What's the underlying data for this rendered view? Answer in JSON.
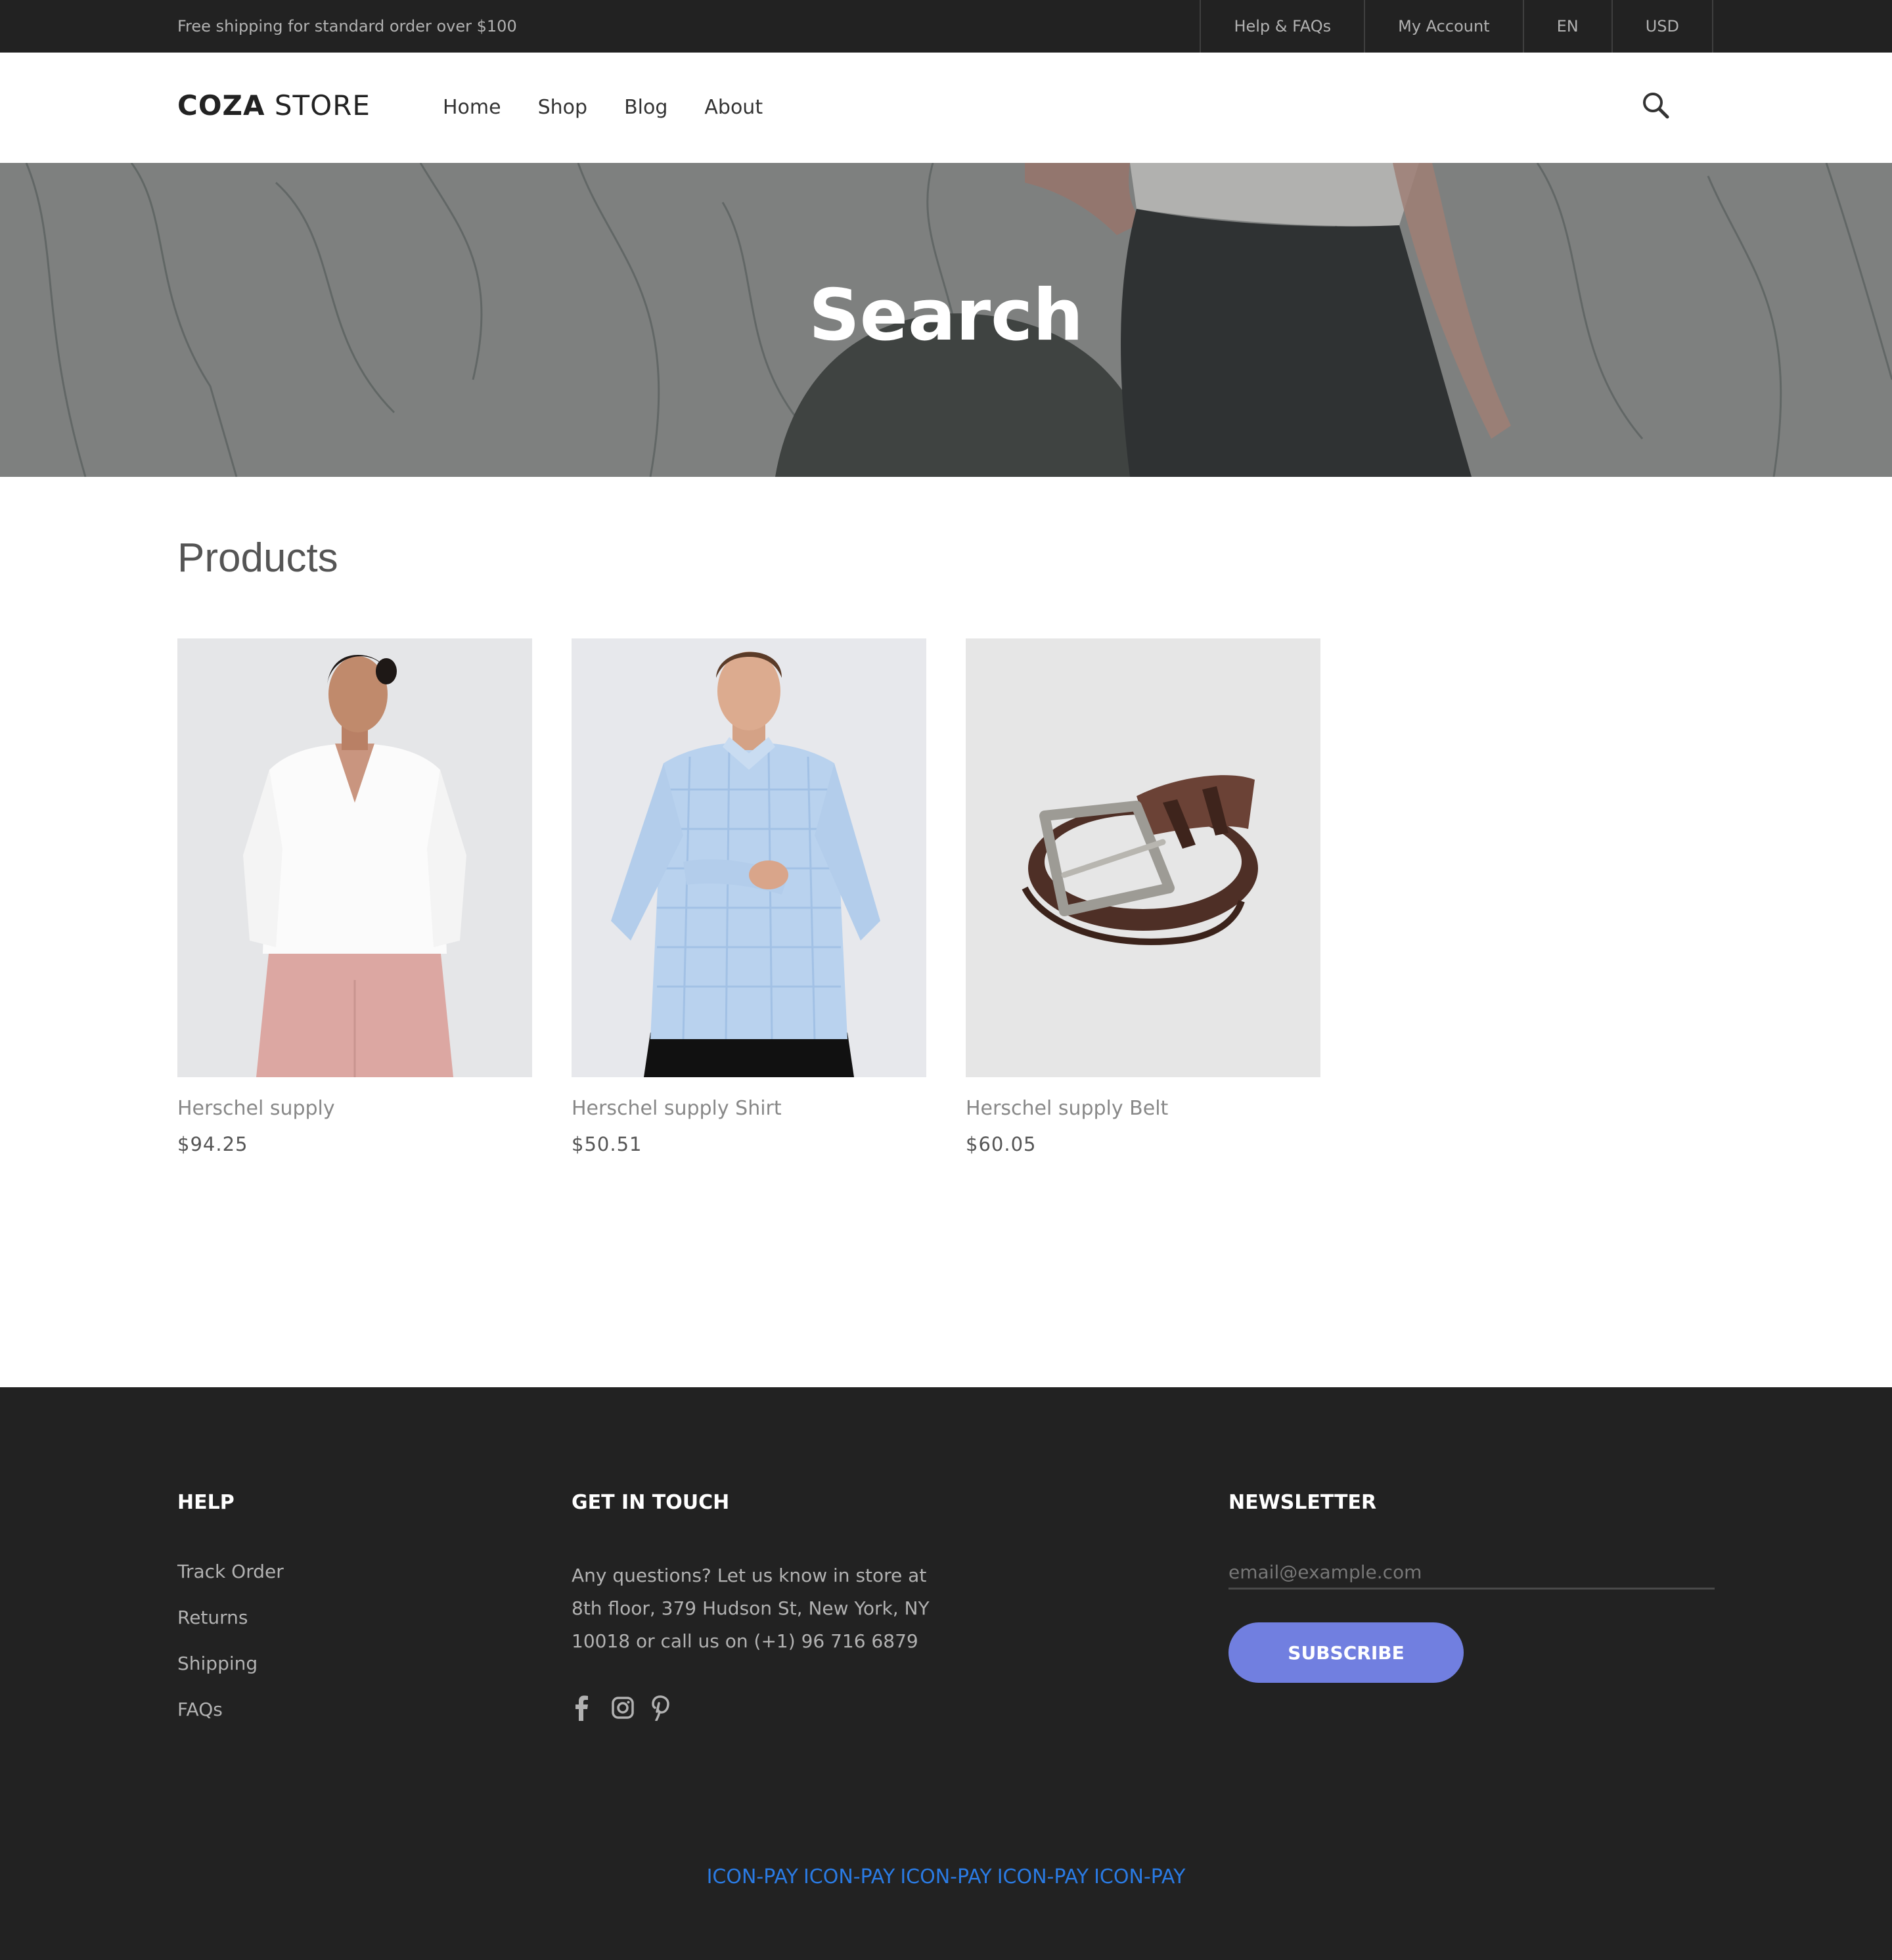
{
  "topbar": {
    "promo": "Free shipping for standard order over $100",
    "links": [
      "Help & FAQs",
      "My Account",
      "EN",
      "USD"
    ]
  },
  "header": {
    "logo_bold": "COZA",
    "logo_light": " STORE",
    "nav": [
      "Home",
      "Shop",
      "Blog",
      "About"
    ],
    "search_icon": "search-icon"
  },
  "hero": {
    "title": "Search"
  },
  "products": {
    "title": "Products",
    "items": [
      {
        "name": "Herschel supply",
        "price": "$94.25",
        "image": "woman-white-blouse-pink-trousers"
      },
      {
        "name": "Herschel supply Shirt",
        "price": "$50.51",
        "image": "man-blue-gingham-shirt"
      },
      {
        "name": "Herschel supply Belt",
        "price": "$60.05",
        "image": "brown-leather-belt"
      }
    ]
  },
  "footer": {
    "help": {
      "title": "HELP",
      "items": [
        "Track Order",
        "Returns",
        "Shipping",
        "FAQs"
      ]
    },
    "contact": {
      "title": "GET IN TOUCH",
      "text": "Any questions? Let us know in store at 8th floor, 379 Hudson St, New York, NY 10018 or call us on (+1) 96 716 6879",
      "socials": [
        "facebook-icon",
        "instagram-icon",
        "pinterest-icon"
      ]
    },
    "newsletter": {
      "title": "NEWSLETTER",
      "placeholder": "email@example.com",
      "button": "SUBSCRIBE"
    },
    "payments": [
      "ICON-PAY",
      "ICON-PAY",
      "ICON-PAY",
      "ICON-PAY",
      "ICON-PAY"
    ]
  },
  "colors": {
    "dark": "#222222",
    "accent": "#717fe0",
    "payment_link": "#2a7be4"
  }
}
